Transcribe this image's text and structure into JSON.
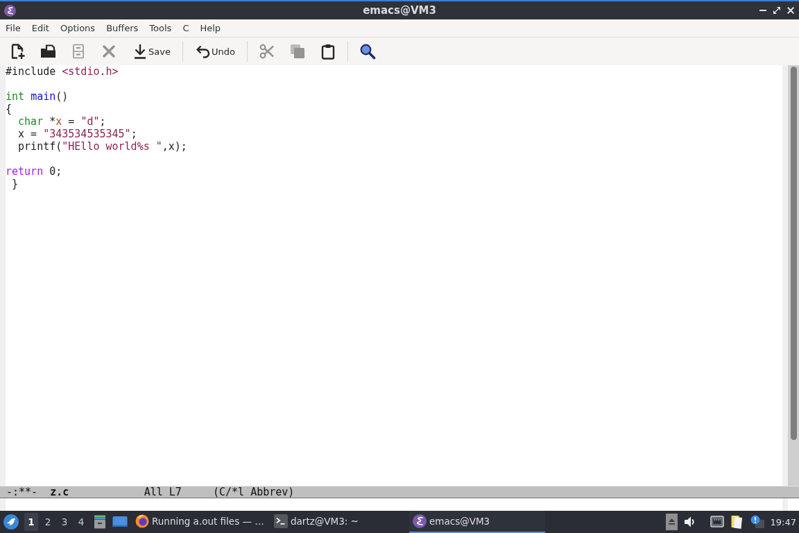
{
  "window": {
    "title": "emacs@VM3"
  },
  "menu": [
    "File",
    "Edit",
    "Options",
    "Buffers",
    "Tools",
    "C",
    "Help"
  ],
  "toolbar": {
    "groups": [
      {
        "items": [
          {
            "disabled": false
          },
          {
            "disabled": false
          },
          {
            "disabled": true
          },
          {
            "disabled": true
          },
          {
            "label": "Save",
            "disabled": false
          }
        ]
      },
      {
        "items": [
          {
            "label": "Undo",
            "disabled": false
          }
        ]
      },
      {
        "items": [
          {
            "disabled": true
          },
          {
            "disabled": true
          },
          {
            "disabled": false
          }
        ]
      },
      {
        "items": [
          {
            "disabled": false
          }
        ]
      }
    ]
  },
  "editor": {
    "lines": [
      {
        "kind": "code",
        "tokens": [
          {
            "text": "#include ",
            "kind": "plain"
          },
          {
            "text": "<stdio.h>",
            "kind": "string"
          }
        ]
      },
      {
        "kind": "blank"
      },
      {
        "kind": "code",
        "tokens": [
          {
            "text": "int ",
            "kind": "type"
          },
          {
            "text": "main",
            "kind": "function"
          },
          {
            "text": "()",
            "kind": "plain"
          }
        ]
      },
      {
        "kind": "code",
        "tokens": [
          {
            "text": "{",
            "kind": "plain"
          }
        ]
      },
      {
        "kind": "code",
        "tokens": [
          {
            "text": "  char ",
            "kind": "type"
          },
          {
            "text": "*",
            "kind": "plain"
          },
          {
            "text": "x",
            "kind": "variable"
          },
          {
            "text": " = ",
            "kind": "plain"
          },
          {
            "text": "\"d\"",
            "kind": "string"
          },
          {
            "text": ";",
            "kind": "plain"
          }
        ]
      },
      {
        "kind": "code",
        "tokens": [
          {
            "text": "  x = ",
            "kind": "plain"
          },
          {
            "text": "\"343534535345\"",
            "kind": "string"
          },
          {
            "text": ";",
            "kind": "plain"
          }
        ]
      },
      {
        "kind": "code",
        "tokens": [
          {
            "text": "  printf(",
            "kind": "plain"
          },
          {
            "text": "\"HEllo world%s \"",
            "kind": "string"
          },
          {
            "text": ",x);",
            "kind": "plain"
          }
        ]
      },
      {
        "kind": "blank"
      },
      {
        "kind": "code",
        "tokens": [
          {
            "text": "return ",
            "kind": "keyword"
          },
          {
            "text": "0;",
            "kind": "plain"
          }
        ]
      },
      {
        "kind": "code",
        "tokens": [
          {
            "text": " }",
            "kind": "plain"
          }
        ]
      }
    ]
  },
  "mode_line": {
    "status": "-:**-",
    "buffer": "z.c",
    "position": "All L7",
    "modes": "(C/*l Abbrev)"
  },
  "taskbar": {
    "workspaces": [
      {
        "label": "1",
        "selected": true
      },
      {
        "label": "2",
        "selected": false
      },
      {
        "label": "3",
        "selected": false
      },
      {
        "label": "4",
        "selected": false
      }
    ],
    "tasks": [
      {
        "title": "Running a.out files — …",
        "selected": false
      },
      {
        "title": "dartz@VM3: ~",
        "selected": false
      },
      {
        "title": "emacs@VM3",
        "selected": true
      }
    ],
    "clock": "19:47"
  }
}
